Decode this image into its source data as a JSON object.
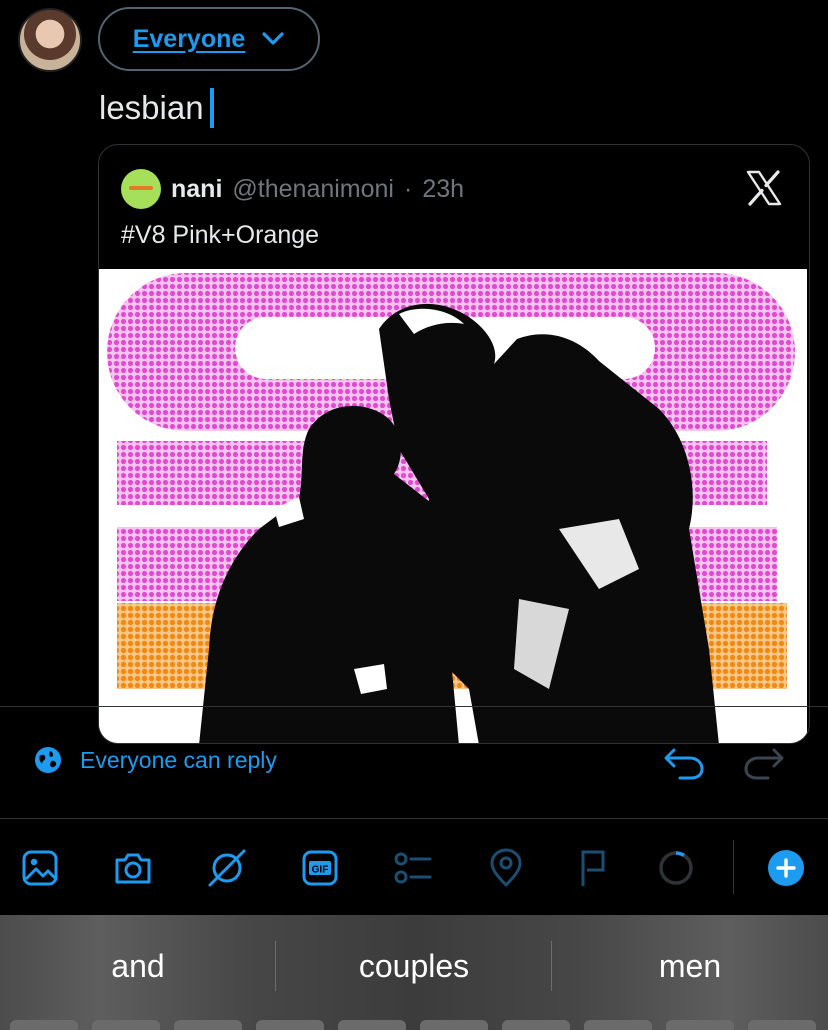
{
  "composer": {
    "audience_label": "Everyone",
    "text": "lesbian"
  },
  "quoted_tweet": {
    "name": "nani",
    "handle": "@thenanimoni",
    "separator": "·",
    "time": "23h",
    "text": "#V8 Pink+Orange",
    "media_icon": "x-logo-icon"
  },
  "reply_settings": {
    "label": "Everyone can reply",
    "icon": "globe-icon"
  },
  "toolbar": {
    "items": [
      "image-icon",
      "camera-icon",
      "grok-icon",
      "gif-icon",
      "poll-icon",
      "location-icon",
      "schedule-icon",
      "character-count-icon",
      "add-post-icon"
    ],
    "gif_label": "GIF"
  },
  "keyboard": {
    "suggestions": [
      "and",
      "couples",
      "men"
    ]
  },
  "colors": {
    "accent": "#1d9bf0",
    "background": "#000000",
    "muted": "#71767b",
    "border": "#2f3336"
  }
}
